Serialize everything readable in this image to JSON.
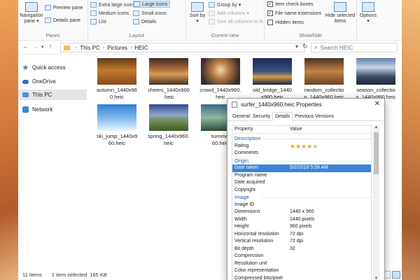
{
  "ribbon": {
    "panes": {
      "label": "Panes",
      "navigation_pane": "Navigation pane",
      "preview_pane": "Preview pane",
      "details_pane": "Details pane"
    },
    "layout": {
      "label": "Layout",
      "extra_large_icons": "Extra large icons",
      "large_icons": "Large icons",
      "medium_icons": "Medium icons",
      "small_icons": "Small icons",
      "list": "List",
      "details": "Details"
    },
    "current_view": {
      "label": "Current view",
      "sort_by": "Sort by",
      "group_by": "Group by",
      "add_columns": "Add columns",
      "size_all_columns": "Size all columns to fit"
    },
    "show_hide": {
      "label": "Show/hide",
      "item_check_boxes": "Item check boxes",
      "file_name_extensions": "File name extensions",
      "hidden_items": "Hidden items",
      "hide_selected_items": "Hide selected items"
    },
    "options": "Options"
  },
  "address": {
    "crumbs": [
      "This PC",
      "Pictures",
      "HEIC"
    ],
    "search_placeholder": "Search HEIC"
  },
  "nav": {
    "items": [
      {
        "label": "Quick access"
      },
      {
        "label": "OneDrive"
      },
      {
        "label": "This PC"
      },
      {
        "label": "Network"
      }
    ]
  },
  "files": [
    {
      "name": "autumn_1440x960.heic",
      "line1": "autumn_1440x96",
      "line2": "0.heic"
    },
    {
      "name": "cheers_1440x960.heic",
      "line1": "cheers_1440x960",
      "line2": ".heic"
    },
    {
      "name": "crowd_1440x960.heic",
      "line1": "crowd_1440x960.",
      "line2": "heic"
    },
    {
      "name": "old_bridge_1440x960.heic",
      "line1": "old_bridge_1440",
      "line2": "x960.heic"
    },
    {
      "name": "random_collection",
      "line1": "random_collectio",
      "line2": "n_1440x960.heic"
    },
    {
      "name": "season_collection",
      "line1": "season_collectio",
      "line2": "n_1440x960.heic"
    },
    {
      "name": "ski_jump_1440x960.heic",
      "line1": "ski_jump_1440x9",
      "line2": "60.heic"
    },
    {
      "name": "spring_1440x960.heic",
      "line1": "spring_1440x960.",
      "line2": "heic"
    },
    {
      "name": "summer",
      "line1": "summer",
      "line2": "60.heic"
    }
  ],
  "status": {
    "items": "11 items",
    "selected": "1 item selected",
    "size": "165 KB"
  },
  "dialog": {
    "title": "surfer_1440x960.heic Properties",
    "close": "✕",
    "tabs": [
      "General",
      "Security",
      "Details",
      "Previous Versions"
    ],
    "header": {
      "property": "Property",
      "value": "Value"
    },
    "rows": [
      {
        "type": "section",
        "key": "Description",
        "value": ""
      },
      {
        "type": "rating",
        "key": "Rating",
        "value": ""
      },
      {
        "type": "row",
        "key": "Comments",
        "value": ""
      },
      {
        "type": "section",
        "key": "Origin",
        "value": ""
      },
      {
        "type": "row",
        "key": "Date taken",
        "value": "5/2/2018 5:59 AM",
        "selected": true
      },
      {
        "type": "row",
        "key": "Program name",
        "value": ""
      },
      {
        "type": "row",
        "key": "Date acquired",
        "value": ""
      },
      {
        "type": "row",
        "key": "Copyright",
        "value": ""
      },
      {
        "type": "section",
        "key": "Image",
        "value": ""
      },
      {
        "type": "row",
        "key": "Image ID",
        "value": ""
      },
      {
        "type": "row",
        "key": "Dimensions",
        "value": "1440 x 960"
      },
      {
        "type": "row",
        "key": "Width",
        "value": "1440 pixels"
      },
      {
        "type": "row",
        "key": "Height",
        "value": "960 pixels"
      },
      {
        "type": "row",
        "key": "Horizontal resolution",
        "value": "72 dpi"
      },
      {
        "type": "row",
        "key": "Vertical resolution",
        "value": "72 dpi"
      },
      {
        "type": "row",
        "key": "Bit depth",
        "value": "32"
      },
      {
        "type": "row",
        "key": "Compression",
        "value": ""
      },
      {
        "type": "row",
        "key": "Resolution unit",
        "value": ""
      },
      {
        "type": "row",
        "key": "Color representation",
        "value": ""
      },
      {
        "type": "row",
        "key": "Compressed bits/pixel",
        "value": ""
      }
    ],
    "rating_stars": 4,
    "rating_max": 5
  },
  "colors": {
    "accent": "#3a84d8",
    "selection": "#cce4f7",
    "section_text": "#1a5fb4",
    "star": "#e8a41d"
  }
}
